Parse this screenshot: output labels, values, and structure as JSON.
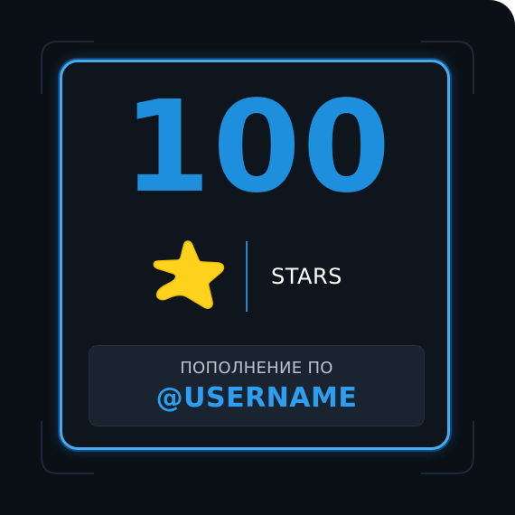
{
  "card": {
    "amount": "100",
    "unit": "STARS",
    "icon": "star-icon",
    "star_color": "#ffd21e",
    "accent_color": "#1e8fdc",
    "topup_caption": "ПОПОЛНЕНИЕ ПО",
    "username": "@USERNAME"
  }
}
